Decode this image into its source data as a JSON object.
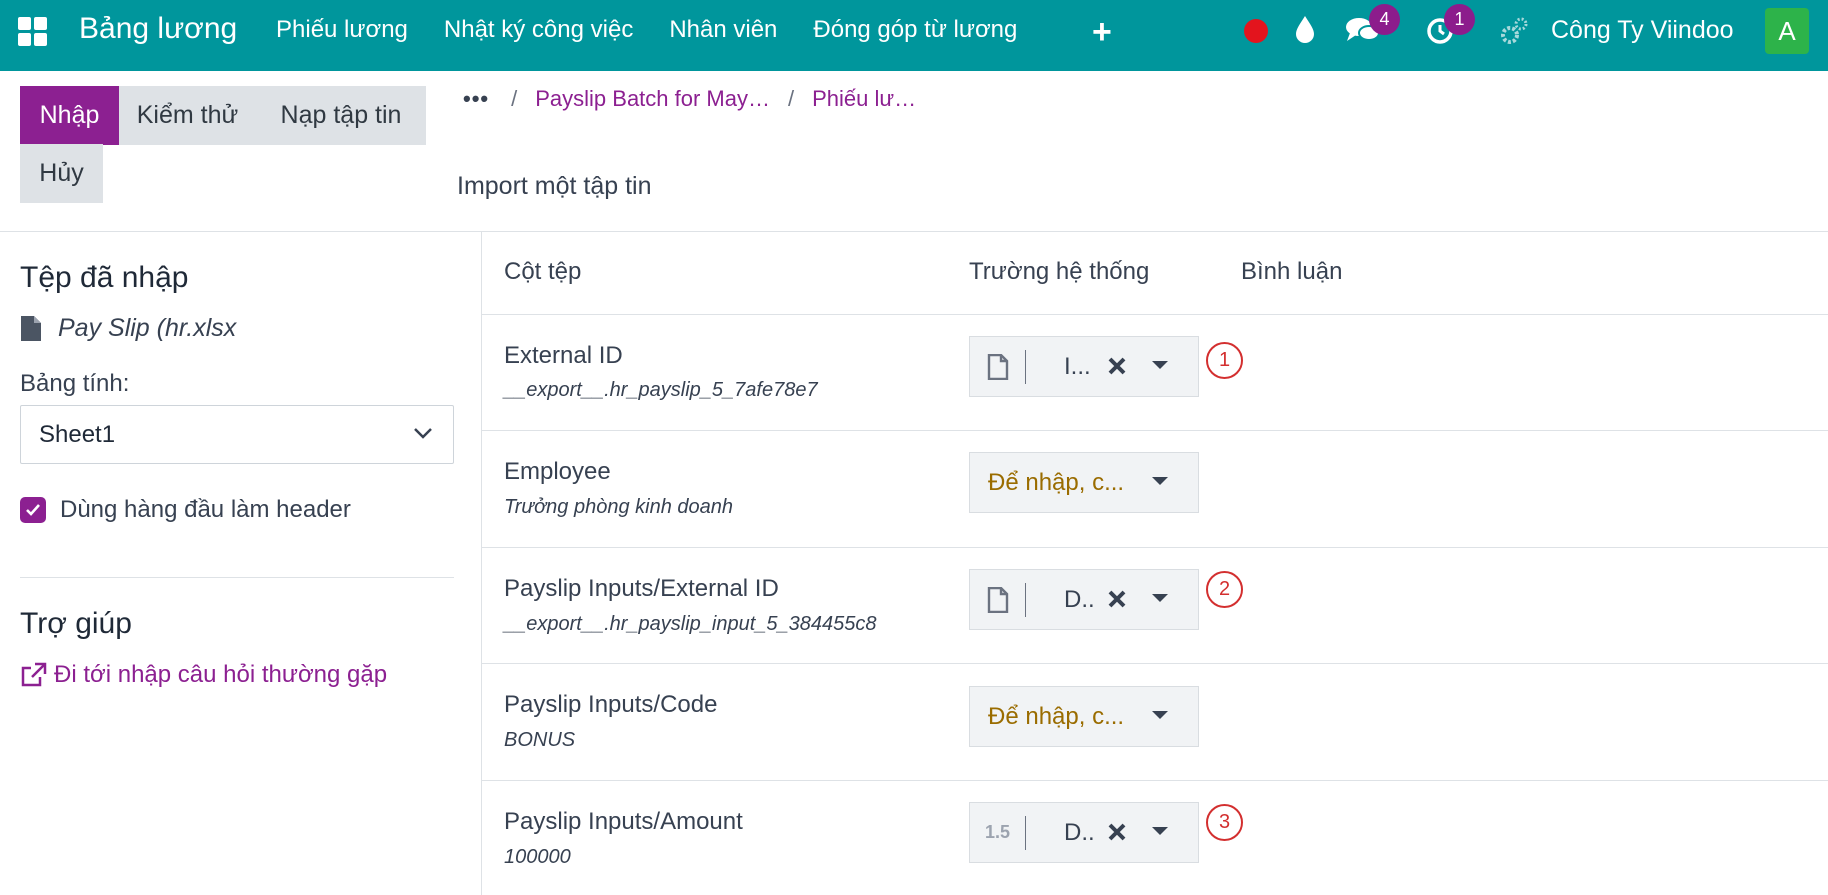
{
  "navbar": {
    "app_title": "Bảng lương",
    "menu": [
      "Phiếu lương",
      "Nhật ký công việc",
      "Nhân viên",
      "Đóng góp từ lương"
    ],
    "plus": "+",
    "messages_badge": "4",
    "activities_badge": "1",
    "company": "Công Ty Viindoo",
    "avatar_letter": "A",
    "bg_color": "#00969c"
  },
  "control_panel": {
    "buttons": {
      "import": "Nhập",
      "test": "Kiểm thử",
      "load_file": "Nạp tập tin",
      "cancel": "Hủy"
    },
    "breadcrumb": {
      "dots": "•••",
      "items": [
        "Payslip Batch for May…",
        "Phiếu lư…"
      ],
      "sep": "/"
    },
    "page_title": "Import một tập tin"
  },
  "sidebar": {
    "imported_title": "Tệp đã nhập",
    "file_name": "Pay Slip (hr.xlsx",
    "sheet_label": "Bảng tính:",
    "sheet_value": "Sheet1",
    "header_checkbox_label": "Dùng hàng đầu làm header",
    "help_title": "Trợ giúp",
    "help_link": "Đi tới nhập câu hỏi thường gặp"
  },
  "table": {
    "headers": [
      "Cột tệp",
      "Trường hệ thống",
      "Bình luận"
    ],
    "rows": [
      {
        "name": "External ID",
        "sample": "__export__.hr_payslip_5_7afe78e7",
        "field": "I...",
        "type_icon": "file-icon",
        "marker": "1"
      },
      {
        "name": "Employee",
        "sample": "Trưởng phòng kinh doanh",
        "field": "Để nhập, c...",
        "type_icon": "",
        "marker": ""
      },
      {
        "name": "Payslip Inputs/External ID",
        "sample": "__export__.hr_payslip_input_5_384455c8",
        "field": "D..",
        "type_icon": "file-icon",
        "marker": "2"
      },
      {
        "name": "Payslip Inputs/Code",
        "sample": "BONUS",
        "field": "Để nhập, c...",
        "type_icon": "",
        "marker": ""
      },
      {
        "name": "Payslip Inputs/Amount",
        "sample": "100000",
        "field": "D..",
        "type_icon": "1.5",
        "marker": "3"
      }
    ]
  }
}
